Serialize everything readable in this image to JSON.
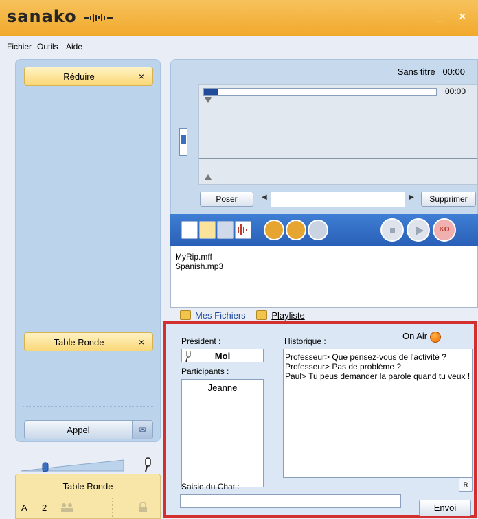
{
  "app": {
    "logo": "sanako",
    "window_controls": "_ ×"
  },
  "menu": {
    "items": [
      "Fichier",
      "Outils",
      "Aide"
    ]
  },
  "left": {
    "reduire_label": "Réduire",
    "table_ronde_label": "Table Ronde",
    "close_glyph": "×",
    "appel_label": "Appel",
    "mail_glyph": "✉",
    "box_title": "Table Ronde",
    "box_letter": "A",
    "box_count": "2"
  },
  "player": {
    "title": "Sans titre",
    "time_top": "00:00",
    "time_progress": "00:00",
    "poser_label": "Poser",
    "supprimer_label": "Supprimer",
    "record_label": "KO"
  },
  "files": {
    "items": [
      "MyRip.mff",
      "Spanish.mp3"
    ],
    "tab_mes": "Mes Fichiers",
    "tab_play": "Playliste"
  },
  "chat": {
    "president_label": "Président :",
    "president_name": "Moi",
    "participants_label": "Participants :",
    "participants": [
      "Jeanne"
    ],
    "historique_label": "Historique :",
    "on_air": "On Air",
    "history": [
      "Professeur> Que pensez-vous de l'activité ?",
      "Professeur> Pas de problème ?",
      "Paul> Tu peus demander la parole quand tu veux !"
    ],
    "saisie_label": "Saisie du Chat :",
    "input_value": "",
    "envoi_label": "Envoi",
    "rec_icon_label": "R"
  },
  "colors": {
    "accent": "#f1a92c",
    "highlight_border": "#d32f2f",
    "toolbar": "#2a60b7"
  }
}
